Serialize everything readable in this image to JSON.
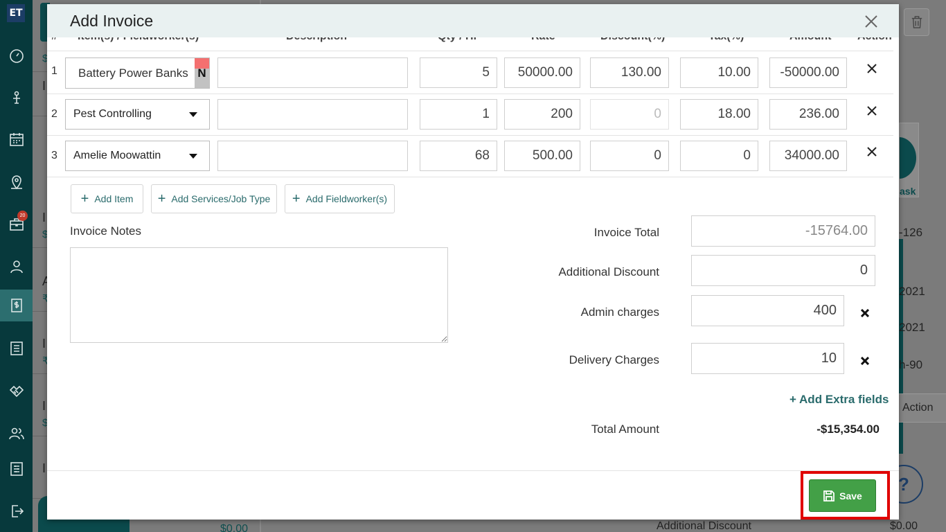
{
  "app": {
    "logo": "ET"
  },
  "sidebar": {
    "icons": [
      "dashboard-icon",
      "pin-icon",
      "calendar-icon",
      "map-pin-icon",
      "briefcase-icon",
      "user-icon",
      "dollar-icon",
      "list-icon",
      "handshake-icon",
      "users-icon",
      "settings-sliders-icon",
      "logout-icon"
    ],
    "badge": "20",
    "active": "dollar-icon"
  },
  "background": {
    "list_items": [
      {
        "l1": "I",
        "l2": "$"
      },
      {
        "l1": "I",
        "l2": "$"
      },
      {
        "l1": "I",
        "l2": "$"
      },
      {
        "l1": "A",
        "l2": "₹"
      },
      {
        "l1": "I",
        "l2": "₹"
      },
      {
        "l1": "I",
        "l2": "$"
      },
      {
        "l1": "I",
        "l2": ""
      }
    ],
    "right_texts": {
      "t1": "-126",
      "t2": "2021",
      "t3": "2021",
      "t4": "h-90"
    },
    "action_label": "Action",
    "logo_text": "ask",
    "help": "?",
    "bottom_amount": "$0.00",
    "bottom_label": "Additional Discount",
    "bottom_right_amount": "$0.00"
  },
  "modal": {
    "title": "Add Invoice",
    "columns": [
      "#",
      "Item(s) / Fieldworker(s)",
      "Description",
      "Qty / Hr",
      "Rate",
      "Discount(%)",
      "Tax(%)",
      "Amount",
      "Action"
    ],
    "rows": [
      {
        "num": "1",
        "item": "Battery Power Banks",
        "flag": "N",
        "description": "",
        "qty": "5",
        "rate": "50000.00",
        "discount": "130.00",
        "tax": "10.00",
        "amount": "-50000.00"
      },
      {
        "num": "2",
        "item": "Pest Controlling",
        "description": "",
        "qty": "1",
        "rate": "200",
        "discount": "0",
        "tax": "18.00",
        "amount": "236.00"
      },
      {
        "num": "3",
        "item": "Amelie Moowattin",
        "description": "",
        "qty": "68",
        "rate": "500.00",
        "discount": "0",
        "tax": "0",
        "amount": "34000.00"
      }
    ],
    "buttons": {
      "add_item": "Add Item",
      "add_services": "Add Services/Job Type",
      "add_fieldworker": "Add Fieldworker(s)"
    },
    "notes": {
      "label": "Invoice Notes",
      "value": ""
    },
    "summary": {
      "invoice_total_label": "Invoice Total",
      "invoice_total": "-15764.00",
      "additional_discount_label": "Additional Discount",
      "additional_discount": "0",
      "admin_charges_label": "Admin charges",
      "admin_charges": "400",
      "delivery_charges_label": "Delivery Charges",
      "delivery_charges": "10",
      "add_extra_fields": "Add Extra fields",
      "total_amount_label": "Total Amount",
      "total_amount": "-$15,354.00"
    },
    "save_label": "Save"
  },
  "colors": {
    "accent": "#2a6b6c",
    "save": "#43a047",
    "highlight": "#e00000",
    "sidebar": "#07393c"
  }
}
